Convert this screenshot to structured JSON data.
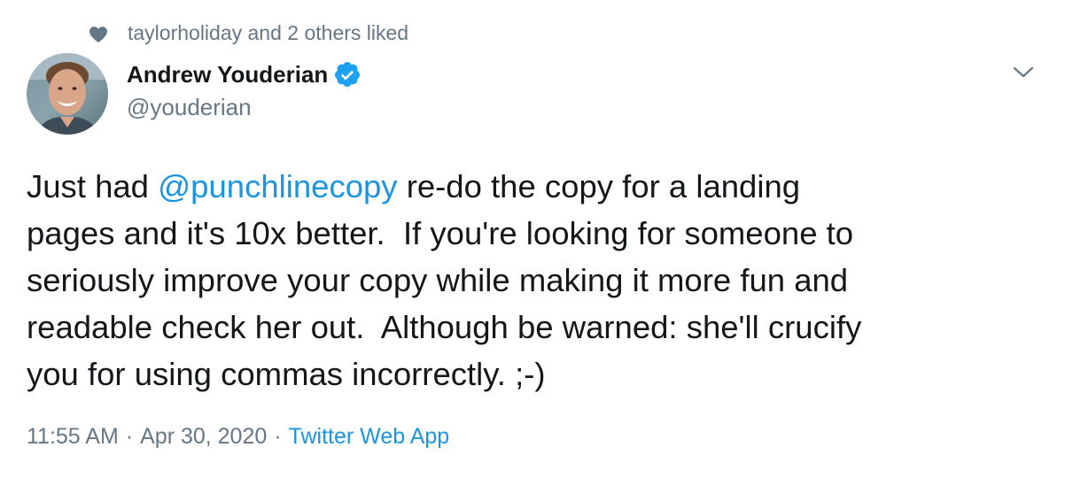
{
  "social_context": {
    "text": "taylorholiday and 2 others liked",
    "icon": "heart-icon"
  },
  "author": {
    "name": "Andrew Youderian",
    "handle": "@youderian",
    "verified": true,
    "avatar": "avatar-photo"
  },
  "tweet": {
    "text_before": "Just had ",
    "mention": "@punchlinecopy",
    "text_after": " re-do the copy for a landing\npages and it's 10x better.  If you're looking for someone to\nseriously improve your copy while making it more fun and\nreadable check her out.  Although be warned: she'll crucify\nyou for using commas incorrectly. ;-)"
  },
  "meta": {
    "time": "11:55 AM",
    "separator": "·",
    "date": "Apr 30, 2020",
    "source": "Twitter Web App"
  },
  "colors": {
    "link": "#1b95e0",
    "secondary": "#657786",
    "text": "#14171a",
    "verified": "#1da1f2"
  }
}
